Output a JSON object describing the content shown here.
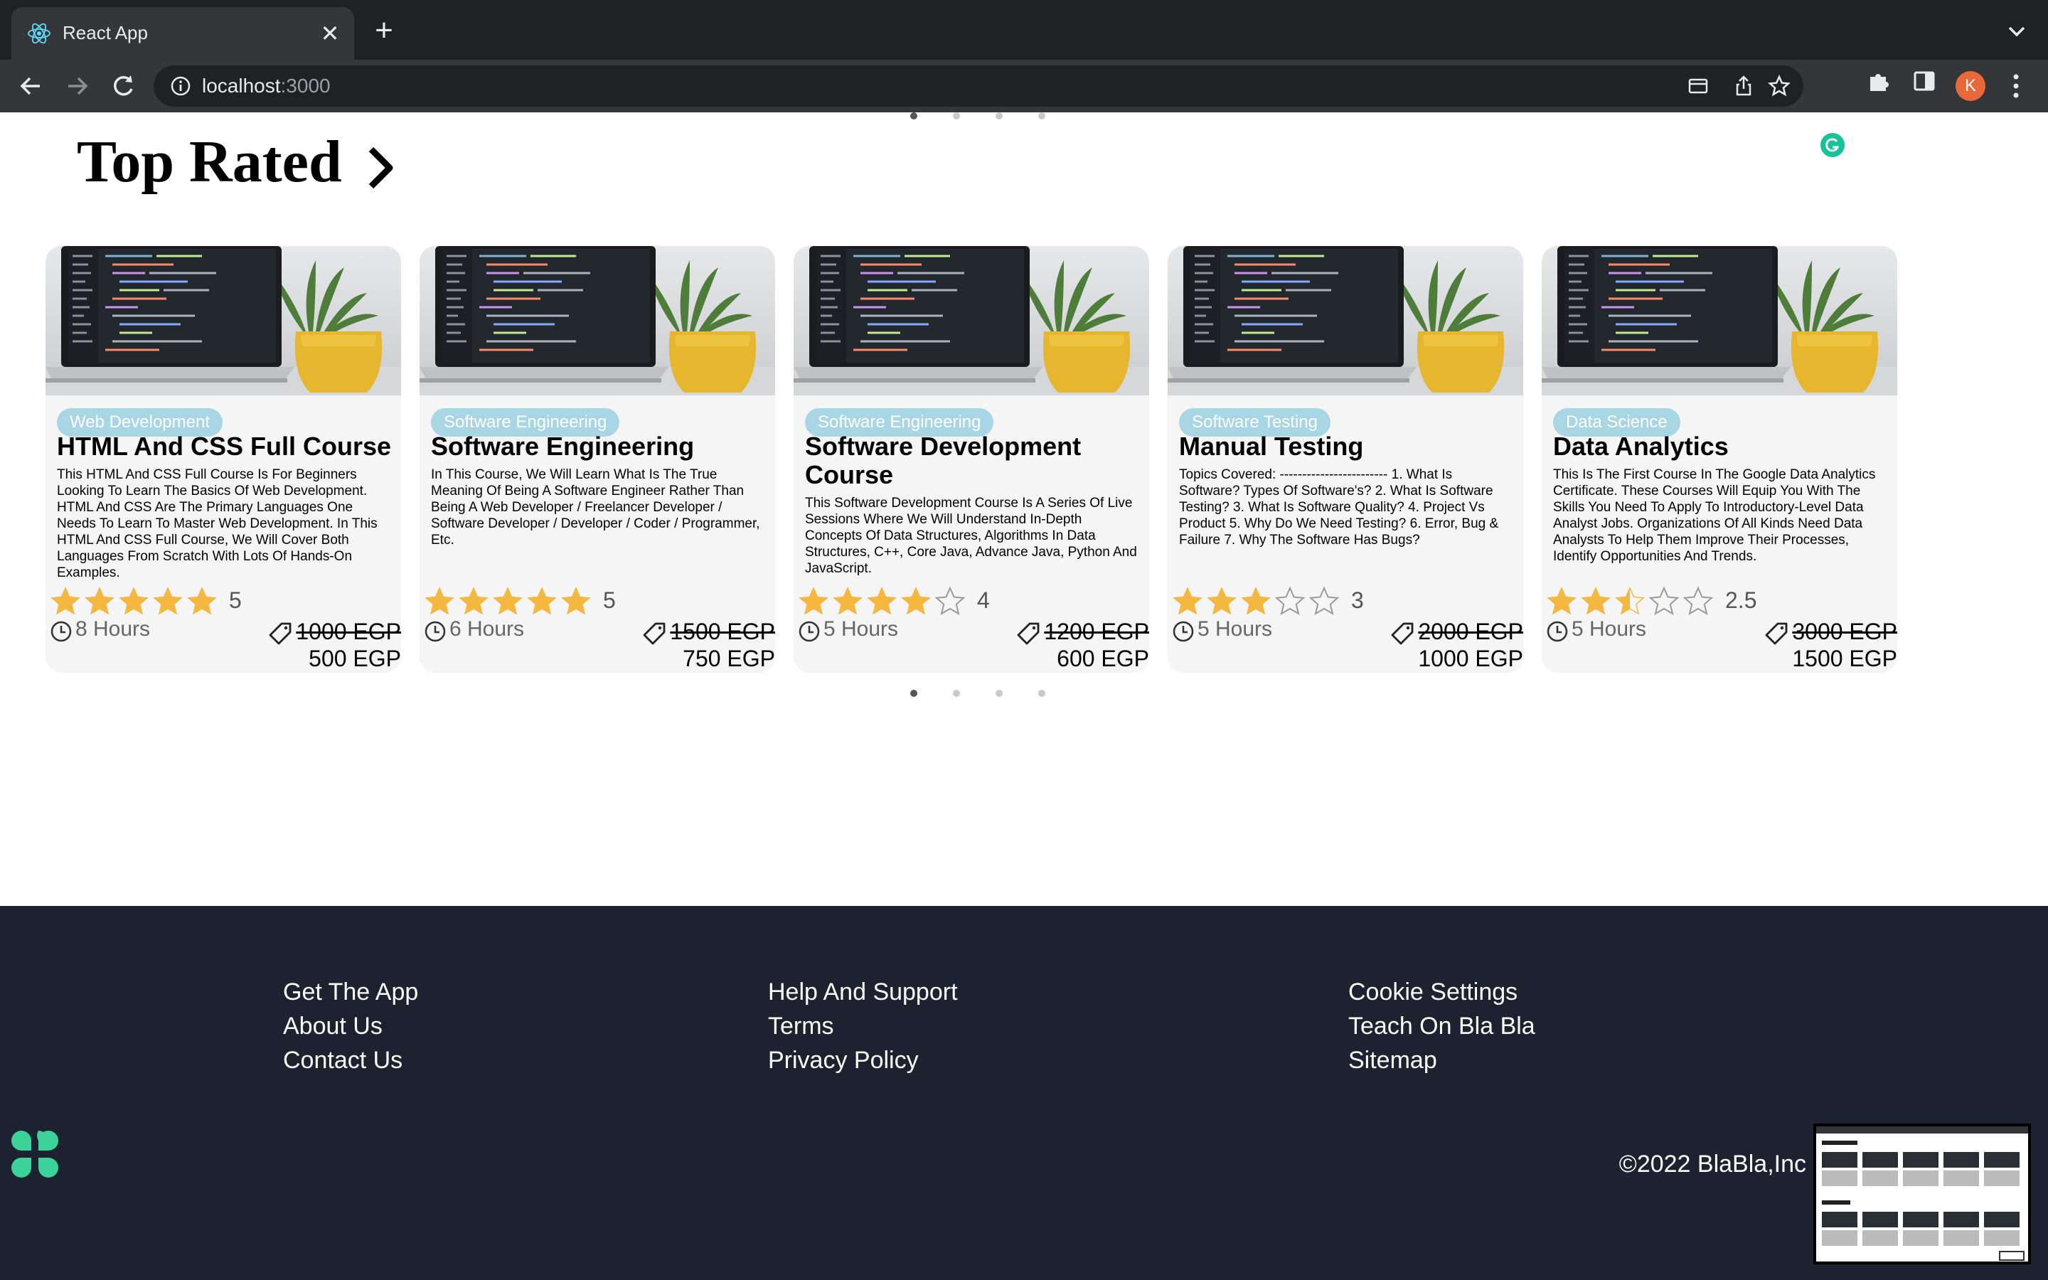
{
  "browser": {
    "tab_title": "React App",
    "url_host": "localhost",
    "url_port": ":3000",
    "avatar_letter": "K"
  },
  "section": {
    "title": "Top Rated"
  },
  "courses": [
    {
      "category": "Web Development",
      "title": "HTML And CSS Full Course",
      "description": "This HTML And CSS Full Course Is For Beginners Looking To Learn The Basics Of Web Development. HTML And CSS Are The Primary Languages One Needs To Learn To Master Web Development. In This HTML And CSS Full Course, We Will Cover Both Languages From Scratch With Lots Of Hands-On Examples.",
      "rating": 5,
      "rating_label": "5",
      "hours": "8 Hours",
      "old_price": "1000 EGP",
      "new_price": "500 EGP"
    },
    {
      "category": "Software Engineering",
      "title": "Software Engineering",
      "description": "In This Course, We Will Learn What Is The True Meaning Of Being A Software Engineer Rather Than Being A Web Developer / Freelancer Developer / Software Developer / Developer / Coder / Programmer, Etc.",
      "rating": 5,
      "rating_label": "5",
      "hours": "6 Hours",
      "old_price": "1500 EGP",
      "new_price": "750 EGP"
    },
    {
      "category": "Software Engineering",
      "title": "Software Development Course",
      "description": "This Software Development Course Is A Series Of Live Sessions Where We Will Understand In-Depth Concepts Of Data Structures, Algorithms In Data Structures, C++, Core Java, Advance Java, Python And JavaScript.",
      "rating": 4,
      "rating_label": "4",
      "hours": "5 Hours",
      "old_price": "1200 EGP",
      "new_price": "600 EGP"
    },
    {
      "category": "Software Testing",
      "title": "Manual Testing",
      "description": "Topics Covered: ------------------------ 1. What Is Software? Types Of Software's? 2. What Is Software Testing? 3. What Is Software Quality? 4. Project Vs Product 5. Why Do We Need Testing? 6. Error, Bug & Failure 7. Why The Software Has Bugs?",
      "rating": 3,
      "rating_label": "3",
      "hours": "5 Hours",
      "old_price": "2000 EGP",
      "new_price": "1000 EGP"
    },
    {
      "category": "Data Science",
      "title": "Data Analytics",
      "description": "This Is The First Course In The Google Data Analytics Certificate. These Courses Will Equip You With The Skills You Need To Apply To Introductory-Level Data Analyst Jobs. Organizations Of All Kinds Need Data Analysts To Help Them Improve Their Processes, Identify Opportunities And Trends.",
      "rating": 2.5,
      "rating_label": "2.5",
      "hours": "5 Hours",
      "old_price": "3000 EGP",
      "new_price": "1500 EGP"
    }
  ],
  "carousel": {
    "pages": 4,
    "active_index": 0
  },
  "footer": {
    "col1": [
      "Get The App",
      "About Us",
      "Contact Us"
    ],
    "col2": [
      "Help And Support",
      "Terms",
      "Privacy Policy"
    ],
    "col3": [
      "Cookie Settings",
      "Teach On Bla Bla",
      "Sitemap"
    ],
    "copyright": "©2022 BlaBla,Inc"
  },
  "colors": {
    "badge": "#a9d6e5",
    "star": "#f4b740",
    "footer_bg": "#1c2230",
    "logo": "#3bd39a"
  }
}
